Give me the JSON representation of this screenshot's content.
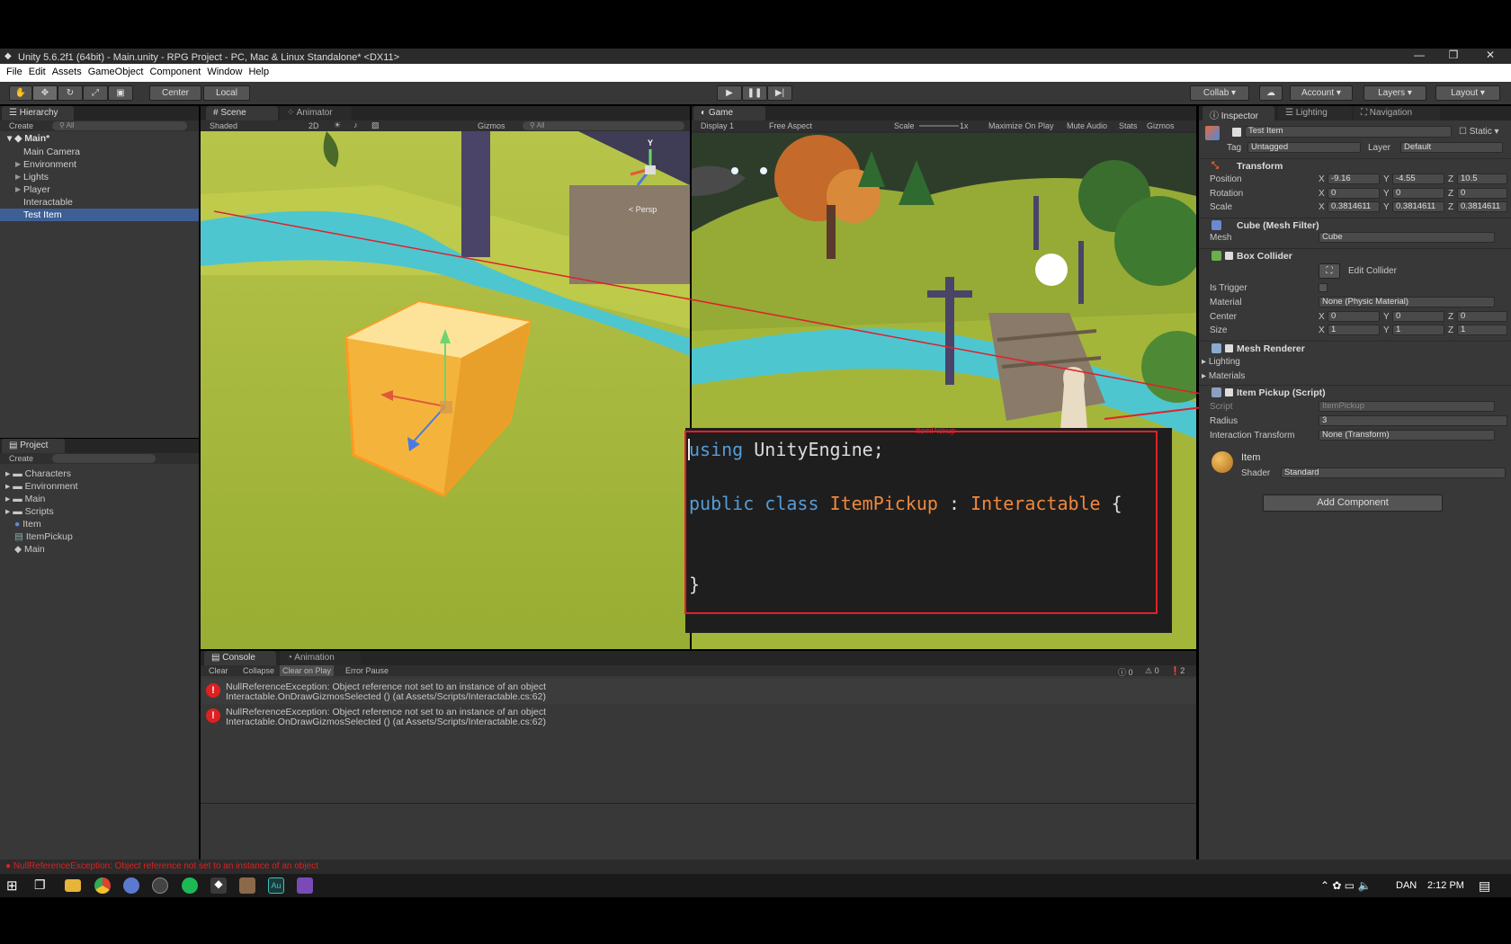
{
  "window": {
    "title": "Unity 5.6.2f1 (64bit) - Main.unity - RPG Project - PC, Mac & Linux Standalone* <DX11>"
  },
  "menu": [
    "File",
    "Edit",
    "Assets",
    "GameObject",
    "Component",
    "Window",
    "Help"
  ],
  "toolbar": {
    "center": "Center",
    "local": "Local",
    "collab": "Collab",
    "account": "Account",
    "layers": "Layers",
    "layout": "Layout"
  },
  "hierarchy": {
    "tab": "Hierarchy",
    "create": "Create",
    "search": "All",
    "scene": "Main*",
    "items": [
      {
        "label": "Main Camera",
        "expandable": false
      },
      {
        "label": "Environment",
        "expandable": true
      },
      {
        "label": "Lights",
        "expandable": true
      },
      {
        "label": "Player",
        "expandable": true
      },
      {
        "label": "Interactable",
        "expandable": false
      },
      {
        "label": "Test Item",
        "expandable": false,
        "selected": true
      }
    ]
  },
  "project": {
    "tab": "Project",
    "create": "Create",
    "items": [
      {
        "label": "Characters",
        "icon": "folder-icon"
      },
      {
        "label": "Environment",
        "icon": "folder-icon"
      },
      {
        "label": "Main",
        "icon": "folder-icon"
      },
      {
        "label": "Scripts",
        "icon": "folder-icon"
      },
      {
        "label": "Item",
        "icon": "material-icon"
      },
      {
        "label": "ItemPickup",
        "icon": "script-icon"
      },
      {
        "label": "Main",
        "icon": "unity-scene-icon"
      }
    ]
  },
  "scene": {
    "tab": "Scene",
    "tab2": "Animator",
    "shaded": "Shaded",
    "mode2d": "2D",
    "gizmos": "Gizmos",
    "search": "All",
    "persp": "Persp",
    "axis_y": "Y"
  },
  "game": {
    "tab": "Game",
    "display": "Display 1",
    "aspect": "Free Aspect",
    "scale_label": "Scale",
    "scale_value": "1x",
    "maximize": "Maximize On Play",
    "mute": "Mute Audio",
    "stats": "Stats",
    "gizmos": "Gizmos"
  },
  "code": {
    "tooltip": "ItemPickup",
    "lines": [
      {
        "parts": [
          {
            "t": "using",
            "c": "kw"
          },
          {
            "t": " UnityEngine;",
            "c": ""
          }
        ]
      },
      {
        "parts": []
      },
      {
        "parts": [
          {
            "t": "public",
            "c": "kw"
          },
          {
            "t": " ",
            "c": ""
          },
          {
            "t": "class",
            "c": "kw"
          },
          {
            "t": " ",
            "c": ""
          },
          {
            "t": "ItemPickup",
            "c": "ty"
          },
          {
            "t": " : ",
            "c": ""
          },
          {
            "t": "Interactable",
            "c": "ty"
          },
          {
            "t": " {",
            "c": ""
          }
        ]
      },
      {
        "parts": []
      },
      {
        "parts": []
      },
      {
        "parts": [
          {
            "t": "}",
            "c": ""
          }
        ]
      }
    ]
  },
  "inspector": {
    "tabs": [
      "Inspector",
      "Lighting",
      "Navigation"
    ],
    "object_name": "Test Item",
    "static": "Static",
    "tag_label": "Tag",
    "tag_value": "Untagged",
    "layer_label": "Layer",
    "layer_value": "Default",
    "transform": {
      "title": "Transform",
      "position_label": "Position",
      "rotation_label": "Rotation",
      "scale_label": "Scale",
      "position": [
        "-9.16",
        "-4.55",
        "10.5"
      ],
      "rotation": [
        "0",
        "0",
        "0"
      ],
      "scale": [
        "0.3814611",
        "0.3814611",
        "0.3814611"
      ]
    },
    "axes": [
      "X",
      "Y",
      "Z"
    ],
    "mesh_filter": {
      "title": "Cube (Mesh Filter)",
      "mesh_label": "Mesh",
      "mesh_value": "Cube"
    },
    "box_collider": {
      "title": "Box Collider",
      "edit": "Edit Collider",
      "is_trigger": "Is Trigger",
      "material_label": "Material",
      "material_value": "None (Physic Material)",
      "center_label": "Center",
      "center": [
        "0",
        "0",
        "0"
      ],
      "size_label": "Size",
      "size": [
        "1",
        "1",
        "1"
      ]
    },
    "mesh_renderer": {
      "title": "Mesh Renderer",
      "lighting": "Lighting",
      "materials": "Materials"
    },
    "item_pickup": {
      "title": "Item Pickup (Script)",
      "script_label": "Script",
      "script_value": "ItemPickup",
      "radius_label": "Radius",
      "radius_value": "3",
      "interaction_label": "Interaction Transform",
      "interaction_value": "None (Transform)"
    },
    "material": {
      "name": "Item",
      "shader_label": "Shader",
      "shader_value": "Standard"
    },
    "add_component": "Add Component"
  },
  "console": {
    "tab": "Console",
    "tab2": "Animation",
    "buttons": [
      "Clear",
      "Collapse",
      "Clear on Play",
      "Error Pause"
    ],
    "counts": {
      "info": "0",
      "warn": "0",
      "error": "2"
    },
    "entries": [
      {
        "line1": "NullReferenceException: Object reference not set to an instance of an object",
        "line2": "Interactable.OnDrawGizmosSelected () (at Assets/Scripts/Interactable.cs:62)"
      },
      {
        "line1": "NullReferenceException: Object reference not set to an instance of an object",
        "line2": "Interactable.OnDrawGizmosSelected () (at Assets/Scripts/Interactable.cs:62)"
      }
    ]
  },
  "status": {
    "message": "NullReferenceException: Object reference not set to an instance of an object"
  },
  "taskbar": {
    "lang": "DAN",
    "time": "2:12 PM"
  },
  "colors": {
    "accent": "#3e5f96",
    "error": "#e02020",
    "annotation": "#e0202a",
    "keyword": "#569cd6",
    "type": "#f0883e"
  }
}
